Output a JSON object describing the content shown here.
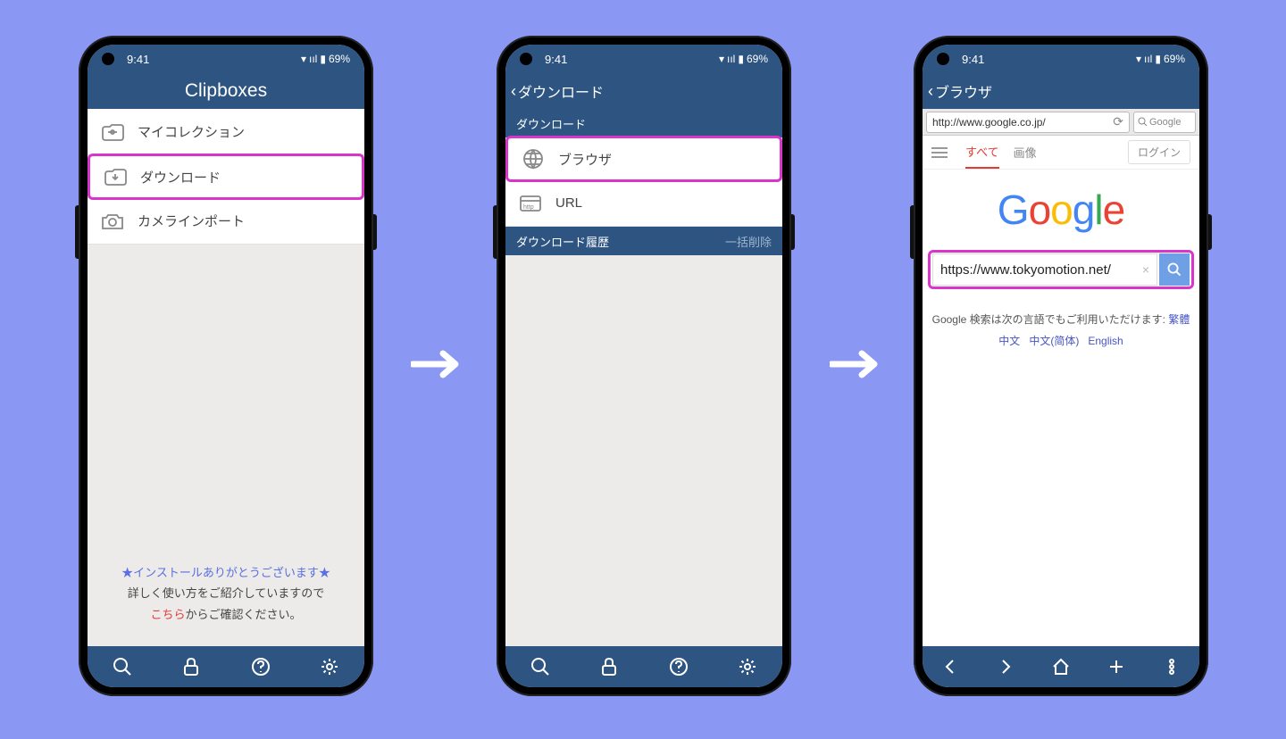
{
  "status": {
    "time": "9:41",
    "battery": "69%"
  },
  "phone1": {
    "title": "Clipboxes",
    "items": [
      {
        "label": "マイコレクション"
      },
      {
        "label": "ダウンロード"
      },
      {
        "label": "カメラインポート"
      }
    ],
    "footer": {
      "thanks": "★インストールありがとうございます★",
      "line1": "詳しく使い方をご紹介していますので",
      "link": "こちら",
      "line2": "からご確認ください。"
    }
  },
  "phone2": {
    "back_title": "ダウンロード",
    "section1": "ダウンロード",
    "items": [
      {
        "label": "ブラウザ"
      },
      {
        "label": "URL"
      }
    ],
    "section2": "ダウンロード履歴",
    "clear": "一括削除"
  },
  "phone3": {
    "back_title": "ブラウザ",
    "url": "http://www.google.co.jp/",
    "search_placeholder": "Google",
    "tabs": {
      "all": "すべて",
      "images": "画像",
      "login": "ログイン"
    },
    "query": "https://www.tokyomotion.net/",
    "lang_prefix": "Google 検索は次の言語でもご利用いただけます:",
    "langs": {
      "zh_tw": "繁體中文",
      "zh_cn": "中文(简体)",
      "en": "English"
    }
  }
}
